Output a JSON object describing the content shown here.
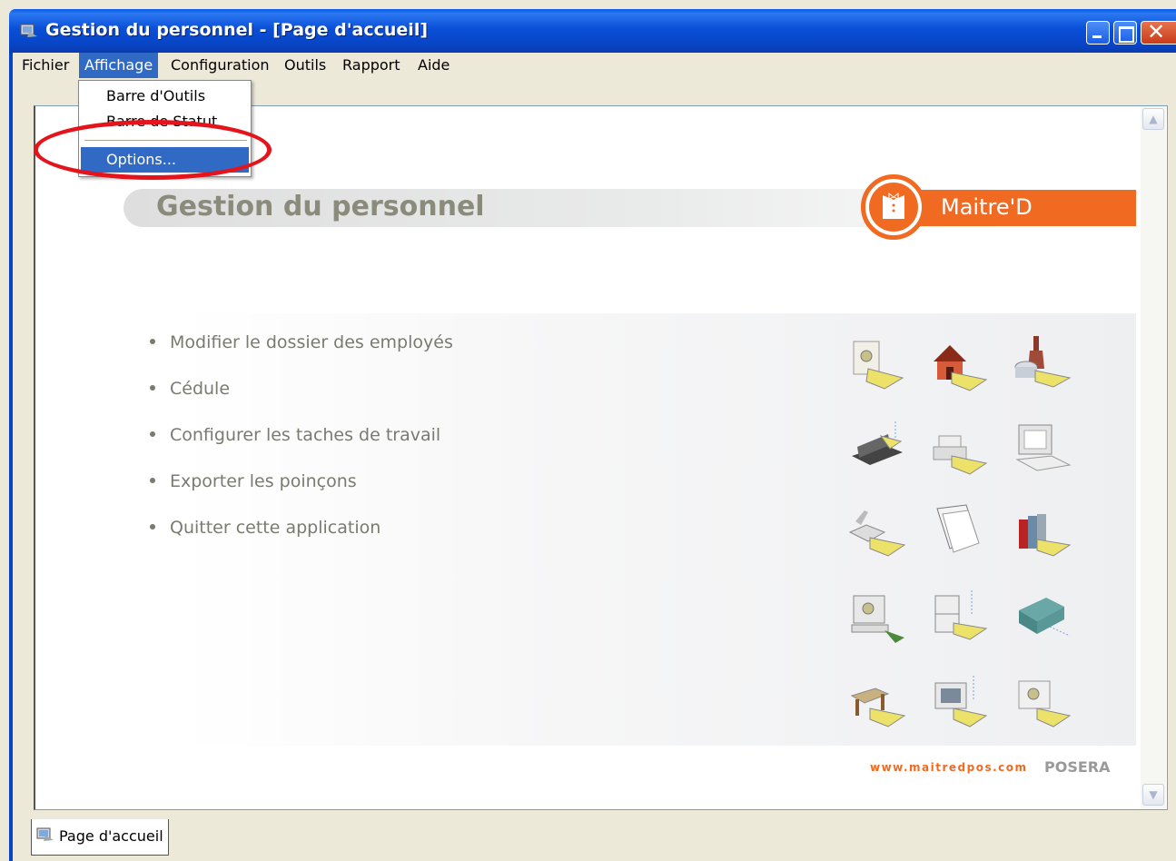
{
  "window": {
    "title": "Gestion du personnel - [Page d'accueil]"
  },
  "menubar": {
    "items": [
      {
        "label": "Fichier"
      },
      {
        "label": "Affichage"
      },
      {
        "label": "Configuration"
      },
      {
        "label": "Outils"
      },
      {
        "label": "Rapport"
      },
      {
        "label": "Aide"
      }
    ]
  },
  "dropdown": {
    "items": [
      {
        "label": "Barre d'Outils"
      },
      {
        "label": "Barre de Statut"
      },
      {
        "label": "Options..."
      }
    ]
  },
  "page": {
    "title": "Gestion du personnel",
    "brand": "Maitre'D",
    "links": [
      {
        "label": "Modifier le dossier des employés"
      },
      {
        "label": "Cédule"
      },
      {
        "label": "Configurer les taches de travail"
      },
      {
        "label": "Exporter les poinçons"
      },
      {
        "label": "Quitter cette application"
      }
    ],
    "footer_url": "www.maitredpos.com",
    "footer_brand": "POSERA"
  },
  "tabs": [
    {
      "label": "Page d'accueil"
    }
  ],
  "colors": {
    "accent": "#f16a22",
    "selection": "#316ac5",
    "annotation": "#e5141c"
  }
}
